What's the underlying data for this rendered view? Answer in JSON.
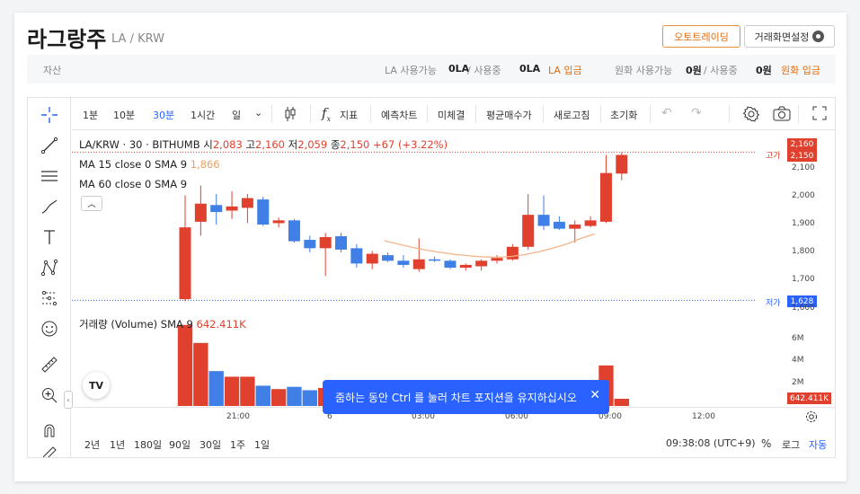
{
  "header": {
    "coin_name": "라그랑주",
    "coin_pair": "LA / KRW",
    "auto_trade_label": "오토트레이딩",
    "screen_setting_label": "거래화면설정"
  },
  "asset_bar": {
    "label": "자산",
    "la_available_label": "LA 사용가능",
    "la_available_value": "0LA",
    "la_in_use_label": "/ 사용중",
    "la_in_use_value": "0LA",
    "la_deposit_label": "LA 입금",
    "krw_available_label": "원화 사용가능",
    "krw_available_value": "0원",
    "krw_in_use_label": "/ 사용중",
    "krw_in_use_value": "0원",
    "krw_deposit_label": "원화 입금"
  },
  "toolbar": {
    "intervals": [
      "1분",
      "10분",
      "30분",
      "1시간",
      "일"
    ],
    "indicator_label": "지표",
    "forecast_label": "예측차트",
    "fine_label": "미체결",
    "avg_buy_label": "평균매수가",
    "refresh_label": "새로고침",
    "reset_label": "초기화"
  },
  "legend": {
    "symbol_line": "LA/KRW · 30 · BITHUMB",
    "open_label": "시",
    "open_value": "2,083",
    "high_label": "고",
    "high_value": "2,160",
    "low_label": "저",
    "low_value": "2,059",
    "close_label": "종",
    "close_value": "2,150",
    "change_value": "+67 (+3.22%)",
    "ma15_label": "MA 15 close 0 SMA 9",
    "ma15_value": "1,866",
    "ma60_label": "MA 60 close 0 SMA 9",
    "volume_label": "거래량 (Volume) SMA 9",
    "volume_value": "642.411K"
  },
  "price_axis": {
    "high_tag": "2,160",
    "close_tag": "2,150",
    "low_tag": "1,628",
    "high_marker": "고가",
    "low_marker": "저가",
    "ticks": [
      "2,100",
      "2,000",
      "1,900",
      "1,800",
      "1,700",
      "1,600"
    ],
    "vol_ticks": [
      "6M",
      "4M",
      "2M"
    ],
    "vol_tag": "642.411K"
  },
  "time_axis": {
    "ticks": [
      "21:00",
      "6",
      "03:00",
      "06:00",
      "09:00",
      "12:00"
    ]
  },
  "bottom_bar": {
    "ranges": [
      "2년",
      "1년",
      "180일",
      "90일",
      "30일",
      "1주",
      "1일"
    ],
    "clock": "09:38:08 (UTC+9)",
    "percent_label": "%",
    "log_label": "로그",
    "auto_label": "자동"
  },
  "toast": {
    "message": "줌하는 동안 Ctrl 를 눌러 차트 포지션을 유지하십시오"
  },
  "tv_logo": "TV",
  "colors": {
    "up": "#e0412f",
    "down": "#3f7fe6",
    "accent": "#2962ff",
    "orange": "#e06d10"
  },
  "chart_data": {
    "type": "candlestick",
    "x_ticks": [
      "21:00",
      "6",
      "03:00",
      "06:00",
      "09:00",
      "12:00"
    ],
    "ylim": [
      1600,
      2180
    ],
    "candles": [
      {
        "o": 1632,
        "h": 2005,
        "l": 1625,
        "c": 1890,
        "dir": "up"
      },
      {
        "o": 1910,
        "h": 2040,
        "l": 1860,
        "c": 1975,
        "dir": "up"
      },
      {
        "o": 1970,
        "h": 2010,
        "l": 1900,
        "c": 1945,
        "dir": "down"
      },
      {
        "o": 1950,
        "h": 2020,
        "l": 1920,
        "c": 1965,
        "dir": "up"
      },
      {
        "o": 1960,
        "h": 2010,
        "l": 1905,
        "c": 1995,
        "dir": "up"
      },
      {
        "o": 1990,
        "h": 2000,
        "l": 1895,
        "c": 1900,
        "dir": "down"
      },
      {
        "o": 1905,
        "h": 1925,
        "l": 1890,
        "c": 1915,
        "dir": "up"
      },
      {
        "o": 1915,
        "h": 1920,
        "l": 1835,
        "c": 1840,
        "dir": "down"
      },
      {
        "o": 1845,
        "h": 1860,
        "l": 1800,
        "c": 1815,
        "dir": "down"
      },
      {
        "o": 1815,
        "h": 1870,
        "l": 1715,
        "c": 1855,
        "dir": "up"
      },
      {
        "o": 1858,
        "h": 1870,
        "l": 1800,
        "c": 1810,
        "dir": "down"
      },
      {
        "o": 1815,
        "h": 1830,
        "l": 1745,
        "c": 1760,
        "dir": "down"
      },
      {
        "o": 1760,
        "h": 1805,
        "l": 1740,
        "c": 1795,
        "dir": "up"
      },
      {
        "o": 1790,
        "h": 1800,
        "l": 1765,
        "c": 1770,
        "dir": "down"
      },
      {
        "o": 1770,
        "h": 1790,
        "l": 1745,
        "c": 1755,
        "dir": "down"
      },
      {
        "o": 1740,
        "h": 1850,
        "l": 1730,
        "c": 1775,
        "dir": "up"
      },
      {
        "o": 1775,
        "h": 1785,
        "l": 1765,
        "c": 1770,
        "dir": "down"
      },
      {
        "o": 1770,
        "h": 1775,
        "l": 1740,
        "c": 1745,
        "dir": "down"
      },
      {
        "o": 1745,
        "h": 1760,
        "l": 1735,
        "c": 1755,
        "dir": "up"
      },
      {
        "o": 1750,
        "h": 1775,
        "l": 1735,
        "c": 1770,
        "dir": "up"
      },
      {
        "o": 1770,
        "h": 1790,
        "l": 1760,
        "c": 1780,
        "dir": "up"
      },
      {
        "o": 1775,
        "h": 1830,
        "l": 1770,
        "c": 1820,
        "dir": "up"
      },
      {
        "o": 1820,
        "h": 2010,
        "l": 1810,
        "c": 1935,
        "dir": "up"
      },
      {
        "o": 1935,
        "h": 2005,
        "l": 1880,
        "c": 1895,
        "dir": "down"
      },
      {
        "o": 1910,
        "h": 1930,
        "l": 1880,
        "c": 1885,
        "dir": "down"
      },
      {
        "o": 1885,
        "h": 1915,
        "l": 1835,
        "c": 1900,
        "dir": "up"
      },
      {
        "o": 1895,
        "h": 1930,
        "l": 1890,
        "c": 1915,
        "dir": "up"
      },
      {
        "o": 1910,
        "h": 2150,
        "l": 1905,
        "c": 2085,
        "dir": "up"
      },
      {
        "o": 2083,
        "h": 2160,
        "l": 2059,
        "c": 2150,
        "dir": "up"
      }
    ],
    "volume_ticks": [
      "6M",
      "4M",
      "2M"
    ],
    "volume_ylim": [
      0,
      7500000
    ],
    "volumes": [
      {
        "v": 7200000,
        "dir": "up"
      },
      {
        "v": 5600000,
        "dir": "up"
      },
      {
        "v": 3100000,
        "dir": "down"
      },
      {
        "v": 2600000,
        "dir": "up"
      },
      {
        "v": 2600000,
        "dir": "up"
      },
      {
        "v": 1800000,
        "dir": "down"
      },
      {
        "v": 1500000,
        "dir": "up"
      },
      {
        "v": 1700000,
        "dir": "down"
      },
      {
        "v": 1400000,
        "dir": "down"
      },
      {
        "v": 1600000,
        "dir": "up"
      },
      {
        "v": 1200000,
        "dir": "down"
      },
      {
        "v": 1100000,
        "dir": "down"
      },
      {
        "v": 1000000,
        "dir": "up"
      },
      {
        "v": 900000,
        "dir": "down"
      },
      {
        "v": 900000,
        "dir": "down"
      },
      {
        "v": 1000000,
        "dir": "up"
      },
      {
        "v": 800000,
        "dir": "down"
      },
      {
        "v": 800000,
        "dir": "down"
      },
      {
        "v": 800000,
        "dir": "up"
      },
      {
        "v": 900000,
        "dir": "up"
      },
      {
        "v": 800000,
        "dir": "up"
      },
      {
        "v": 900000,
        "dir": "up"
      },
      {
        "v": 1500000,
        "dir": "up"
      },
      {
        "v": 1000000,
        "dir": "down"
      },
      {
        "v": 900000,
        "dir": "down"
      },
      {
        "v": 1200000,
        "dir": "up"
      },
      {
        "v": 1300000,
        "dir": "up"
      },
      {
        "v": 3600000,
        "dir": "up"
      },
      {
        "v": 642411,
        "dir": "up"
      }
    ],
    "ma15": [
      1842,
      1830,
      1818,
      1808,
      1800,
      1793,
      1788,
      1784,
      1782,
      1785,
      1792,
      1802,
      1815,
      1830,
      1850,
      1866
    ],
    "ma15_start_index": 13
  }
}
